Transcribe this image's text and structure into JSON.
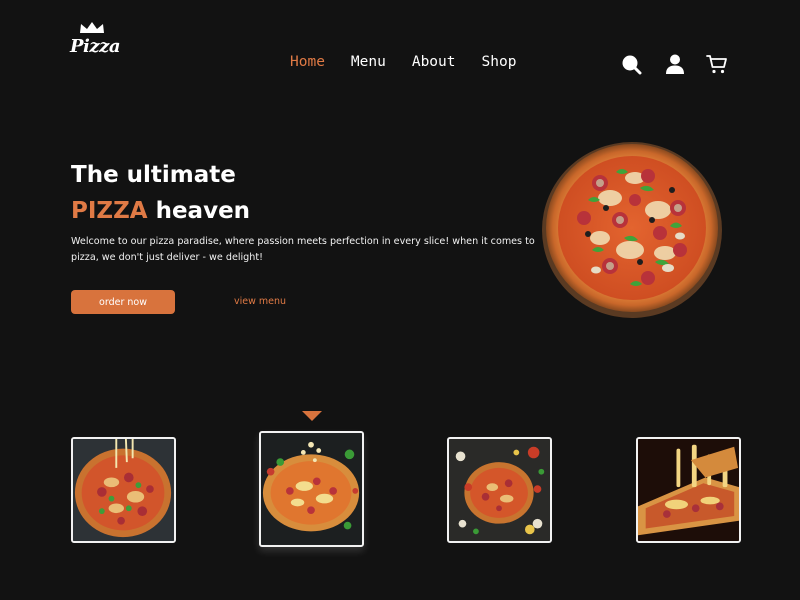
{
  "brand": {
    "logo_text": "Pizza",
    "accent_color": "#e07a45",
    "button_color": "#d8733d",
    "background": "#121212"
  },
  "nav": {
    "items": [
      {
        "label": "Home",
        "active": true
      },
      {
        "label": "Menu",
        "active": false
      },
      {
        "label": "About",
        "active": false
      },
      {
        "label": "Shop",
        "active": false
      }
    ]
  },
  "header_icons": [
    "search-icon",
    "user-icon",
    "cart-icon"
  ],
  "hero": {
    "title_line1": "The ultimate",
    "title_accent": "PIZZA",
    "title_rest": " heaven",
    "description": "Welcome to our pizza paradise, where passion meets perfection in every slice! when it comes to pizza, we don't just deliver - we delight!",
    "order_label": "order now",
    "view_menu_label": "view menu"
  },
  "thumbnails": {
    "items": [
      {
        "name": "pizza-topping-drizzle"
      },
      {
        "name": "pizza-cheese-splash",
        "selected": true
      },
      {
        "name": "pizza-ingredients-spread"
      },
      {
        "name": "pizza-cheese-pull-slice"
      }
    ]
  }
}
